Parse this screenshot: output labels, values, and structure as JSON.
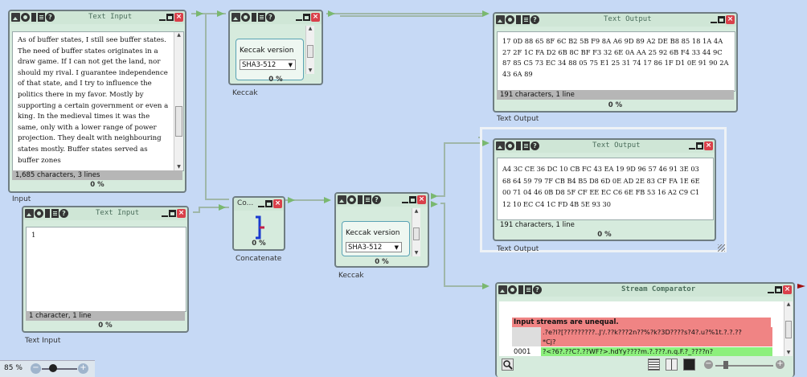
{
  "colors": {
    "canvas": "#c6d9f5",
    "node_body": "#d6ebdd",
    "error_red": "#f08484",
    "ok_green": "#8cf07c",
    "close_red": "#d9404a"
  },
  "icons": [
    "image-icon",
    "gear-icon",
    "bar-icon",
    "document-icon",
    "help-icon",
    "minimize-icon",
    "maximize-icon",
    "close-icon"
  ],
  "nodes": {
    "input1": {
      "title": "Text Input",
      "text": "As of buffer states, I still see buffer states. The need of buffer states originates in a draw game. If I can not get the land, nor should my rival. I guarantee independence of that state, and I try to influence the politics there in my favor. Mostly by supporting a certain government or even a king. In the medieval times it was the same, only with a lower range of power projection. They dealt with neighbouring states mostly. Buffer states served as buffer zones",
      "status": "1,685 characters,  3 lines",
      "percent": "0 %",
      "label": "Input"
    },
    "input2": {
      "title": "Text Input",
      "text": "1",
      "status": "1 character,  1 line",
      "percent": "0 %",
      "label": "Text Input"
    },
    "keccak1": {
      "param_label": "Keccak version",
      "param_value": "SHA3-512",
      "percent": "0 %",
      "label": "Keccak"
    },
    "keccak2": {
      "param_label": "Keccak version",
      "param_value": "SHA3-512",
      "percent": "0 %",
      "label": "Keccak"
    },
    "concat": {
      "title": "Co...",
      "percent": "0 %",
      "label": "Concatenate"
    },
    "output1": {
      "title": "Text Output",
      "text": "17 0D 88 65 8F 6C B2 5B F9 8A A6 9D 89 A2 DE B8 85 18 1A 4A 27 2F 1C FA D2 6B 8C BF F3 32 6E 0A AA 25 92 6B F4 33 44 9C 87 85 C5 73 EC 34 88 05 75 E1 25 31 74 17 86 1F D1 0E 91 90 2A 43 6A 89",
      "status": "191 characters,  1 line",
      "percent": "0 %",
      "label": "Text Output"
    },
    "output2": {
      "title": "Text Output",
      "text": "A4 3C CE 36 DC 10 CB FC 43 EA 19 9D 96 57 46 91 3E 03 68 64 59 79 7F CB B4 B5 D8 6D 0E AD 2E 83 CF FA 1E 6E 00 71 04 46 0B D8 5F CF EE EC C6 6E FB 53 16 A2 C9 C1 12 10 EC C4 1C FD 4B 5E 93 30",
      "status": "191 characters,  1 line",
      "percent": "0 %",
      "label": "Text Output"
    },
    "comparator": {
      "title": "Stream Comparator",
      "header": "Input streams are unequal.",
      "line1": ".?e?l?[?????????..J'/.??k???2n??%?k?3D????s?4?.u?%1t.?.?.??",
      "line1b": "*Cj?",
      "row_num": "0001",
      "line2": "?<?6?.??C?.??WF?>.hdYy????m.?.???.n.q.F.?_????n?"
    }
  },
  "zoom": {
    "level": "85 %",
    "minus": "−",
    "plus": "+"
  }
}
